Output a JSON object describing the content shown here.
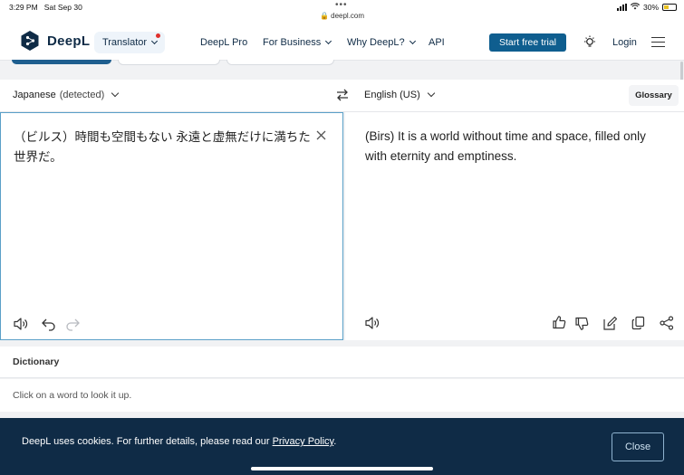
{
  "status_bar": {
    "time": "3:29 PM",
    "date": "Sat Sep 30",
    "url": "deepl.com",
    "battery": "30%"
  },
  "navbar": {
    "brand": "DeepL",
    "translator_label": "Translator",
    "links": [
      "DeepL Pro",
      "For Business",
      "Why DeepL?",
      "API"
    ],
    "cta_label": "Start free trial",
    "login_label": "Login"
  },
  "languages": {
    "source_lang": "Japanese",
    "source_detected": "(detected)",
    "target_lang": "English (US)",
    "glossary_label": "Glossary"
  },
  "source": {
    "text": "（ビルス）時間も空間もない 永遠と虚無だけに満ちた世界だ。"
  },
  "target": {
    "text": "(Birs) It is a world without time and space, filled only with eternity and emptiness."
  },
  "dictionary": {
    "title": "Dictionary",
    "hint": "Click on a word to look it up."
  },
  "cookie": {
    "text_before": "DeepL uses cookies. For further details, please read our ",
    "link": "Privacy Policy",
    "text_after": ".",
    "close_label": "Close"
  },
  "colors": {
    "brand_navy": "#0f2b46",
    "cta_blue": "#0f5e8f",
    "focus_border": "#5aa0c8"
  }
}
